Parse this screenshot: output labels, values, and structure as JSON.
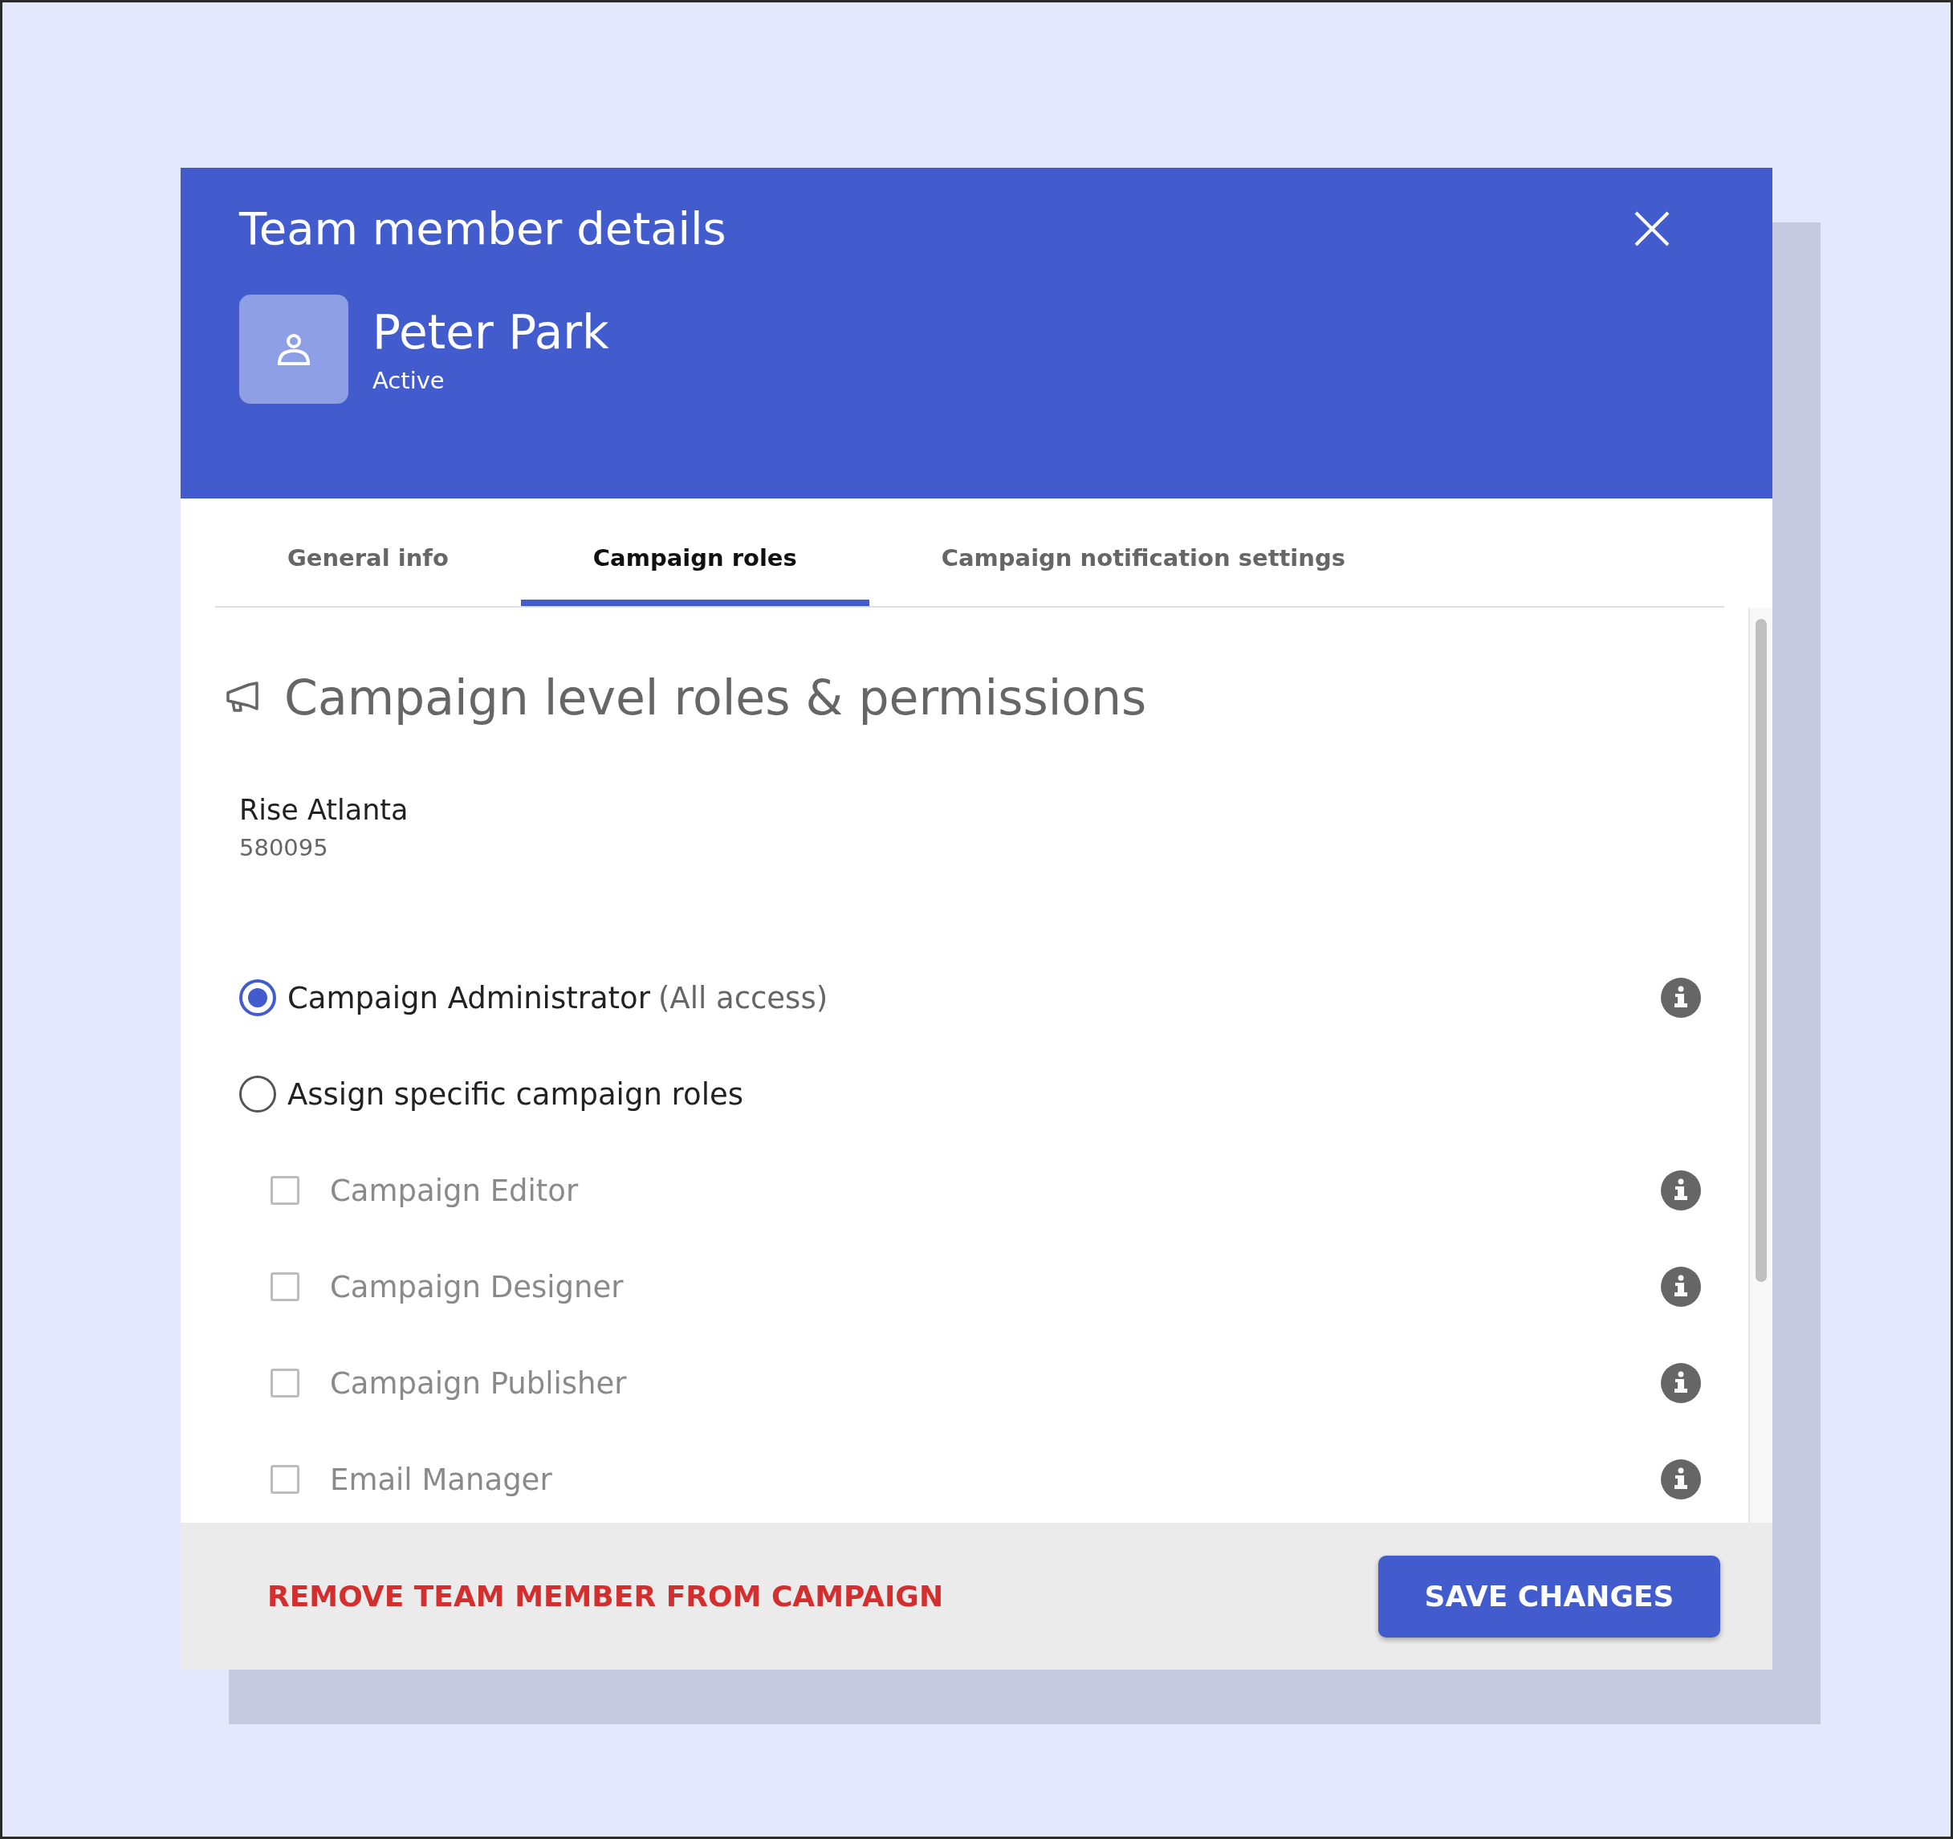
{
  "dialog": {
    "title": "Team member details"
  },
  "member": {
    "name": "Peter Park",
    "status": "Active"
  },
  "tabs": [
    {
      "label": "General info",
      "selected": false
    },
    {
      "label": "Campaign roles",
      "selected": true
    },
    {
      "label": "Campaign notification settings",
      "selected": false
    }
  ],
  "section": {
    "heading": "Campaign level roles & permissions"
  },
  "campaign": {
    "name": "Rise Atlanta",
    "number": "580095"
  },
  "role_modes": [
    {
      "label": "Campaign Administrator",
      "note": "(All access)",
      "selected": true,
      "info": true
    },
    {
      "label": "Assign specific campaign roles",
      "selected": false,
      "info": false
    }
  ],
  "roles": [
    {
      "label": "Campaign Editor",
      "checked": false,
      "disabled": true
    },
    {
      "label": "Campaign Designer",
      "checked": false,
      "disabled": true
    },
    {
      "label": "Campaign Publisher",
      "checked": false,
      "disabled": true
    },
    {
      "label": "Email Manager",
      "checked": false,
      "disabled": true
    }
  ],
  "footer": {
    "remove": "REMOVE TEAM MEMBER FROM CAMPAIGN",
    "save": "SAVE CHANGES"
  }
}
